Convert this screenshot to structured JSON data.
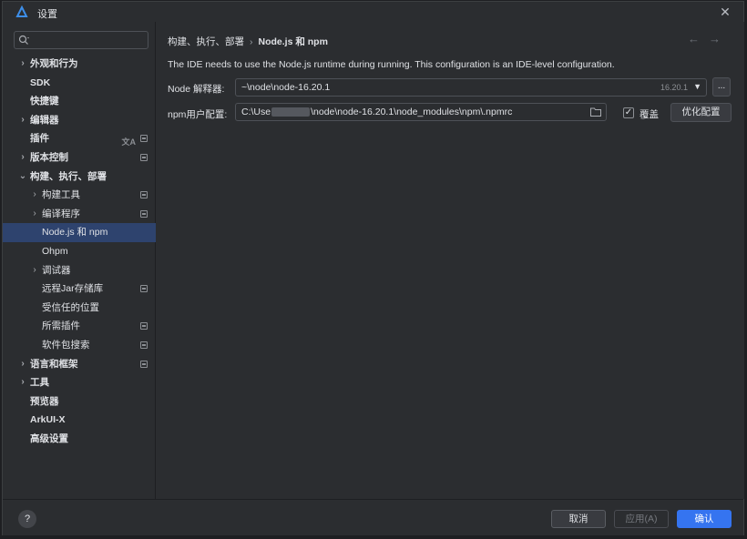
{
  "window": {
    "title": "设置",
    "close_icon": "close-icon"
  },
  "search": {
    "value": "",
    "placeholder": ""
  },
  "tree": [
    {
      "label": "外观和行为",
      "expandable": true,
      "level": 0,
      "bold": true
    },
    {
      "label": "SDK",
      "expandable": false,
      "level": 0,
      "bold": true
    },
    {
      "label": "快捷键",
      "expandable": false,
      "level": 0,
      "bold": true
    },
    {
      "label": "编辑器",
      "expandable": true,
      "level": 0,
      "bold": true
    },
    {
      "label": "插件",
      "expandable": false,
      "level": 0,
      "bold": true,
      "icons": [
        "translate-icon",
        "project-icon"
      ]
    },
    {
      "label": "版本控制",
      "expandable": true,
      "level": 0,
      "bold": true,
      "icons": [
        "project-icon"
      ]
    },
    {
      "label": "构建、执行、部署",
      "expandable": true,
      "expanded": true,
      "level": 0,
      "bold": true
    },
    {
      "label": "构建工具",
      "expandable": true,
      "level": 1,
      "icons": [
        "project-icon"
      ]
    },
    {
      "label": "编译程序",
      "expandable": true,
      "level": 1,
      "icons": [
        "project-icon"
      ]
    },
    {
      "label": "Node.js 和 npm",
      "expandable": false,
      "level": 1,
      "selected": true
    },
    {
      "label": "Ohpm",
      "expandable": false,
      "level": 1
    },
    {
      "label": "调试器",
      "expandable": true,
      "level": 1
    },
    {
      "label": "远程Jar存储库",
      "expandable": false,
      "level": 1,
      "icons": [
        "project-icon"
      ]
    },
    {
      "label": "受信任的位置",
      "expandable": false,
      "level": 1
    },
    {
      "label": "所需插件",
      "expandable": false,
      "level": 1,
      "icons": [
        "project-icon"
      ]
    },
    {
      "label": "软件包搜索",
      "expandable": false,
      "level": 1,
      "icons": [
        "project-icon"
      ]
    },
    {
      "label": "语言和框架",
      "expandable": true,
      "level": 0,
      "bold": true,
      "icons": [
        "project-icon"
      ]
    },
    {
      "label": "工具",
      "expandable": true,
      "level": 0,
      "bold": true
    },
    {
      "label": "预览器",
      "expandable": false,
      "level": 0,
      "bold": true
    },
    {
      "label": "ArkUI-X",
      "expandable": false,
      "level": 0,
      "bold": true
    },
    {
      "label": "高级设置",
      "expandable": false,
      "level": 0,
      "bold": true
    }
  ],
  "breadcrumb": {
    "parent": "构建、执行、部署",
    "separator": "›",
    "current": "Node.js 和 npm"
  },
  "nav": {
    "back": "←",
    "forward": "→"
  },
  "description": "The IDE needs to use the Node.js runtime during running. This configuration is an IDE-level configuration.",
  "node": {
    "label": "Node 解释器:",
    "value": "~\\node\\node-16.20.1",
    "version": "16.20.1",
    "browse": "..."
  },
  "npm": {
    "label": "npm用户配置:",
    "value_prefix": "C:\\Use",
    "value_suffix": "\\node\\node-16.20.1\\node_modules\\npm\\.npmrc",
    "override_checked": true,
    "override_label": "覆盖",
    "optimize_label": "优化配置"
  },
  "footer": {
    "help": "?",
    "cancel": "取消",
    "apply": "应用(A)",
    "ok": "确认"
  },
  "colors": {
    "accent": "#3574f0",
    "selection": "#2e436e",
    "background": "#2b2d30"
  }
}
